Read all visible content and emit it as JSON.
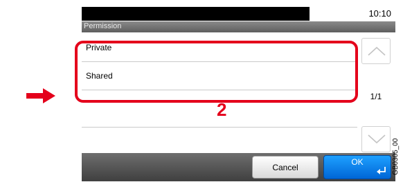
{
  "status_bar": {
    "time": "10:10"
  },
  "screen": {
    "title": "Permission"
  },
  "list": {
    "items": [
      {
        "label": "Private"
      },
      {
        "label": "Shared"
      },
      {
        "label": ""
      },
      {
        "label": ""
      }
    ]
  },
  "scroll": {
    "page_indicator": "1/1"
  },
  "annotation": {
    "step_number": "2"
  },
  "buttons": {
    "cancel": "Cancel",
    "ok": "OK"
  },
  "figure_code": "GB0305_00",
  "colors": {
    "highlight": "#e4001b",
    "ok_button": "#0a84f0",
    "title_bar": "#6e6e6e"
  },
  "icons": {
    "arrow": "right-arrow-icon",
    "up": "chevron-up-icon",
    "down": "chevron-down-icon",
    "enter": "enter-icon"
  }
}
